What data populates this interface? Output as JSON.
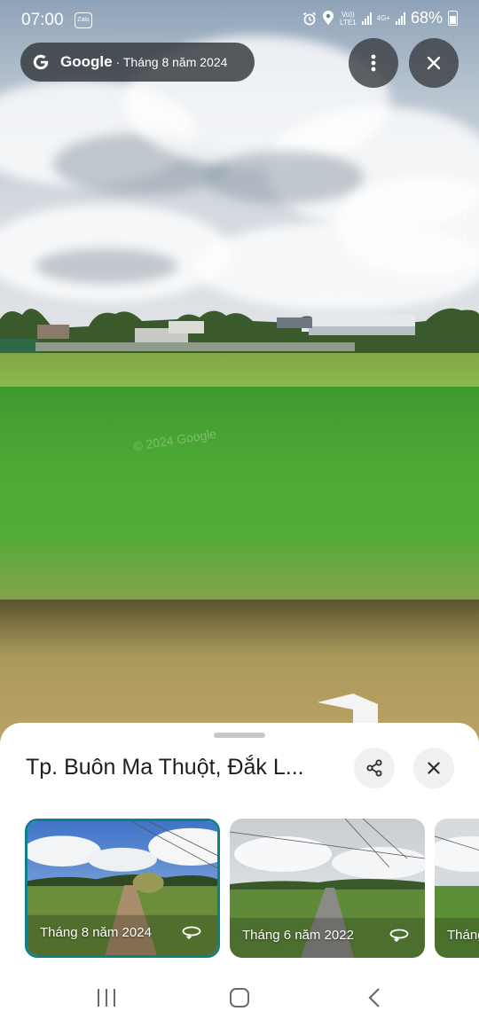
{
  "status_bar": {
    "time": "07:00",
    "notification_app": "Zalo",
    "network_label_top": "Vo))",
    "network_label_bottom": "LTE1",
    "network_type": "4G+",
    "battery": "68%"
  },
  "header": {
    "brand": "Google",
    "capture_date": "· Tháng 8 năm 2024",
    "icons": {
      "more": "more-vert-icon",
      "close": "close-icon"
    }
  },
  "scene": {
    "watermark": "© 2024 Google"
  },
  "sheet": {
    "title": "Tp. Buôn Ma Thuột, Đắk L...",
    "icons": {
      "share": "share-icon",
      "close": "close-icon"
    },
    "thumbnails": [
      {
        "date": "Tháng 8 năm 2024",
        "selected": true,
        "icon": "360-rotate-icon"
      },
      {
        "date": "Tháng 6 năm 2022",
        "selected": false,
        "icon": "360-rotate-icon"
      },
      {
        "date": "Tháng",
        "selected": false
      }
    ]
  },
  "nav_bar": {
    "icons": [
      "recents-icon",
      "home-icon",
      "back-icon"
    ]
  },
  "colors": {
    "selected_border": "#0f7f8a",
    "sheet_bg": "#ffffff",
    "pill_bg": "#32373c"
  }
}
